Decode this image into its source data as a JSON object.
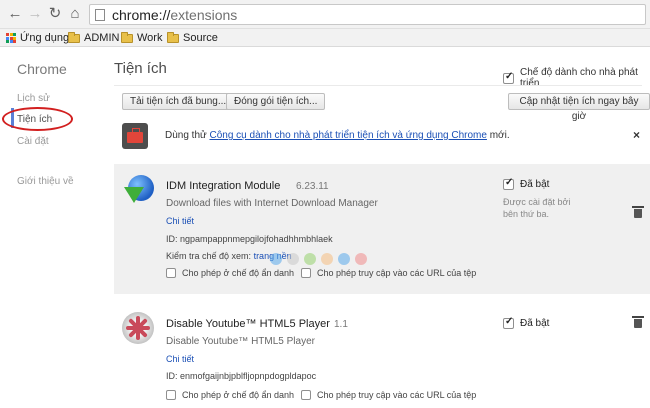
{
  "browser": {
    "url_scheme": "chrome://",
    "url_host": "extensions",
    "bookmarks": [
      {
        "label": "Ứng dụng",
        "icon": "apps-icon"
      },
      {
        "label": "ADMIN",
        "icon": "folder-icon"
      },
      {
        "label": "Work",
        "icon": "folder-icon"
      },
      {
        "label": "Source",
        "icon": "folder-icon"
      }
    ]
  },
  "sidebar": {
    "title": "Chrome",
    "items": [
      {
        "label": "Lịch sử"
      },
      {
        "label": "Tiện ích"
      },
      {
        "label": "Cài đặt"
      },
      {
        "label": "Giới thiệu về"
      }
    ]
  },
  "header": {
    "title": "Tiện ích",
    "developer_mode_label": "Chế độ dành cho nhà phát triển",
    "developer_mode_checked": true
  },
  "toolbar": {
    "load_unpacked_label": "Tải tiện ích đã bung...",
    "pack_label": "Đóng gói tiện ích...",
    "update_label": "Cập nhật tiện ích ngay bây giờ"
  },
  "promo": {
    "prefix": "Dùng thử ",
    "link": "Công cụ dành cho nhà phát triển tiện ích và ứng dụng Chrome",
    "suffix": " mới.",
    "close": "×"
  },
  "extensions": [
    {
      "name": "IDM Integration Module",
      "version": "6.23.11",
      "description": "Download files with Internet Download Manager",
      "details_link": "Chi tiết",
      "id": "ID: ngpampappnmepgilojfohadhhmbhlaek",
      "inspect_label": "Kiểm tra chế độ xem:",
      "inspect_link": "trang nền",
      "incognito_label": "Cho phép ở chế độ ẩn danh",
      "file_url_label": "Cho phép truy cập vào các URL của tệp",
      "enabled_label": "Đã bật",
      "enabled": true,
      "policy_line1": "Được cài đặt bởi",
      "policy_line2": "bên thứ ba."
    },
    {
      "name": "Disable Youtube™ HTML5 Player",
      "version": "1.1",
      "description": "Disable Youtube™ HTML5 Player",
      "details_link": "Chi tiết",
      "id": "ID: enmofgaijnbjpblfljopnpdogpldapoc",
      "incognito_label": "Cho phép ở chế độ ẩn danh",
      "file_url_label": "Cho phép truy cập vào các URL của tệp",
      "enabled_label": "Đã bật",
      "enabled": true
    }
  ],
  "watermark": "Download.com.vn",
  "colors": {
    "link": "#1a4fb5",
    "annotation": "#d21f1f",
    "card_bg": "#f0f0f0"
  }
}
